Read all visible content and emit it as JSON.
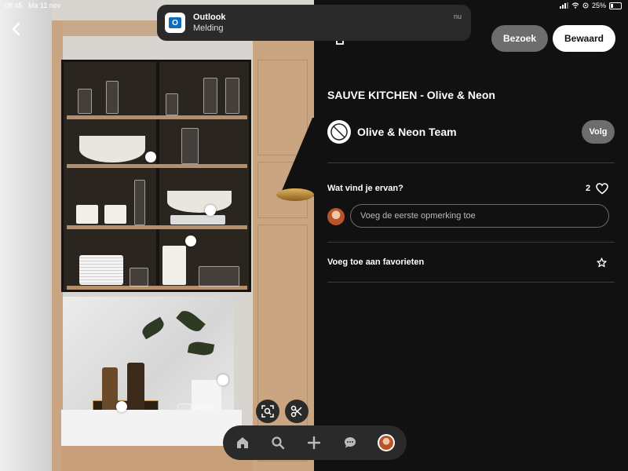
{
  "status": {
    "time": "08:45",
    "date": "Ma 11 nov",
    "battery": "25%"
  },
  "notification": {
    "app": "Outlook",
    "message": "Melding",
    "time": "nu",
    "icon_letter": "O"
  },
  "header": {
    "visit_label": "Bezoek",
    "save_label": "Bewaard"
  },
  "pin": {
    "title": "SAUVE KITCHEN - Olive & Neon",
    "author": "Olive & Neon Team",
    "follow_label": "Volg"
  },
  "comments": {
    "question": "Wat vind je ervan?",
    "likes": "2",
    "placeholder": "Voeg de eerste opmerking toe"
  },
  "favorites": {
    "label": "Voeg toe aan favorieten"
  },
  "nav": {
    "items": [
      "home-icon",
      "search-icon",
      "plus-icon",
      "chat-icon",
      "profile-avatar"
    ]
  },
  "colors": {
    "background": "#111111",
    "button_gray": "#6d6d6d",
    "save_button": "#ffffff",
    "outlook_blue": "#0f6cbd"
  }
}
